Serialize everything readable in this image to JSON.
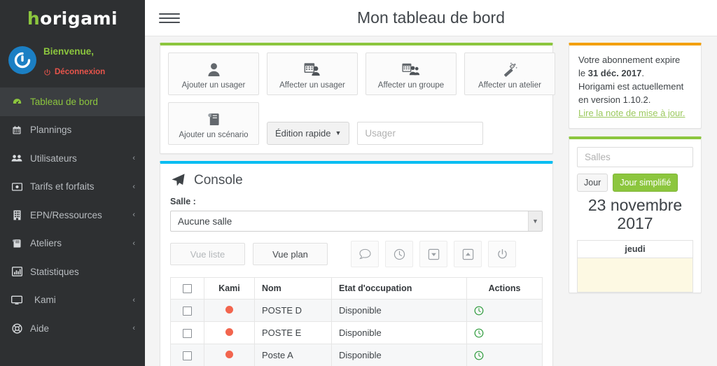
{
  "brand": {
    "name_start": "h",
    "name_rest": "origami"
  },
  "sidebar": {
    "user": {
      "welcome": "Bienvenue,",
      "logout": "Déconnexion",
      "avatar_icon": "gravatar-avatar-icon"
    },
    "items": [
      {
        "label": "Tableau de bord",
        "icon": "dashboard-icon",
        "active": true,
        "caret": ""
      },
      {
        "label": "Plannings",
        "icon": "calendar-icon",
        "active": false,
        "caret": ""
      },
      {
        "label": "Utilisateurs",
        "icon": "users-icon",
        "active": false,
        "caret": "‹"
      },
      {
        "label": "Tarifs et forfaits",
        "icon": "money-icon",
        "active": false,
        "caret": "‹"
      },
      {
        "label": "EPN/Ressources",
        "icon": "building-icon",
        "active": false,
        "caret": "‹"
      },
      {
        "label": "Ateliers",
        "icon": "book-icon",
        "active": false,
        "caret": "‹"
      },
      {
        "label": "Statistiques",
        "icon": "bar-chart-icon",
        "active": false,
        "caret": ""
      },
      {
        "label": "Kami",
        "icon": "monitor-icon",
        "active": false,
        "caret": "‹"
      },
      {
        "label": "Aide",
        "icon": "life-ring-icon",
        "active": false,
        "caret": "‹"
      }
    ]
  },
  "header": {
    "title": "Mon tableau de bord",
    "menu_icon": "hamburger-menu-icon"
  },
  "quick_actions": {
    "tiles": [
      {
        "label": "Ajouter un usager",
        "icon": "user-icon"
      },
      {
        "label": "Affecter un usager",
        "icon": "calendar-user-icon"
      },
      {
        "label": "Affecter un groupe",
        "icon": "calendar-group-icon"
      },
      {
        "label": "Affecter un atelier",
        "icon": "magic-wand-icon"
      },
      {
        "label": "Ajouter un scénario",
        "icon": "book-icon"
      }
    ],
    "edition_button": "Édition rapide",
    "edition_caret_icon": "caret-down-icon",
    "usager_placeholder": "Usager",
    "usager_value": ""
  },
  "console": {
    "title": "Console",
    "title_icon": "paper-plane-icon",
    "room_label": "Salle :",
    "room_selected": "Aucune salle",
    "room_options": [
      "Aucune salle"
    ],
    "view_list": "Vue liste",
    "view_plan": "Vue plan",
    "icon_buttons": [
      {
        "icon": "comment-icon"
      },
      {
        "icon": "clock-icon"
      },
      {
        "icon": "download-box-icon"
      },
      {
        "icon": "upload-box-icon"
      },
      {
        "icon": "power-icon"
      }
    ],
    "table": {
      "headers": [
        "",
        "Kami",
        "Nom",
        "Etat d'occupation",
        "Actions"
      ],
      "select_all_icon": "checkbox-icon",
      "rows": [
        {
          "checkbox": "checkbox-icon",
          "kami": "status-dot-red",
          "nom": "POSTE D",
          "etat": "Disponible",
          "action_icon": "clock-icon"
        },
        {
          "checkbox": "checkbox-icon",
          "kami": "status-dot-red",
          "nom": "POSTE E",
          "etat": "Disponible",
          "action_icon": "clock-icon"
        },
        {
          "checkbox": "checkbox-icon",
          "kami": "status-dot-red",
          "nom": "Poste A",
          "etat": "Disponible",
          "action_icon": "clock-icon"
        }
      ]
    }
  },
  "subscription": {
    "line1_a": "Votre abonnement expire",
    "line1_b": "le ",
    "expiry_date": "31 déc. 2017",
    "line1_c": ".",
    "line2": "Horigami est actuellement",
    "line3": "en version 1.10.2.",
    "link": "Lire la note de mise à jour."
  },
  "calendar": {
    "rooms_placeholder": "Salles",
    "rooms_value": "",
    "btn_day": "Jour",
    "btn_day_simple": "Jour simplifié",
    "date_line1": "23 novembre",
    "date_line2": "2017",
    "day_of_week": "jeudi"
  },
  "colors": {
    "accent_green": "#8cc63e",
    "accent_blue": "#00bdf2",
    "accent_orange": "#f3a009",
    "sidebar_bg": "#2e3032",
    "logout_red": "#e8544b",
    "status_red": "#f2654e",
    "avatar_blue": "#1b7fc4"
  }
}
